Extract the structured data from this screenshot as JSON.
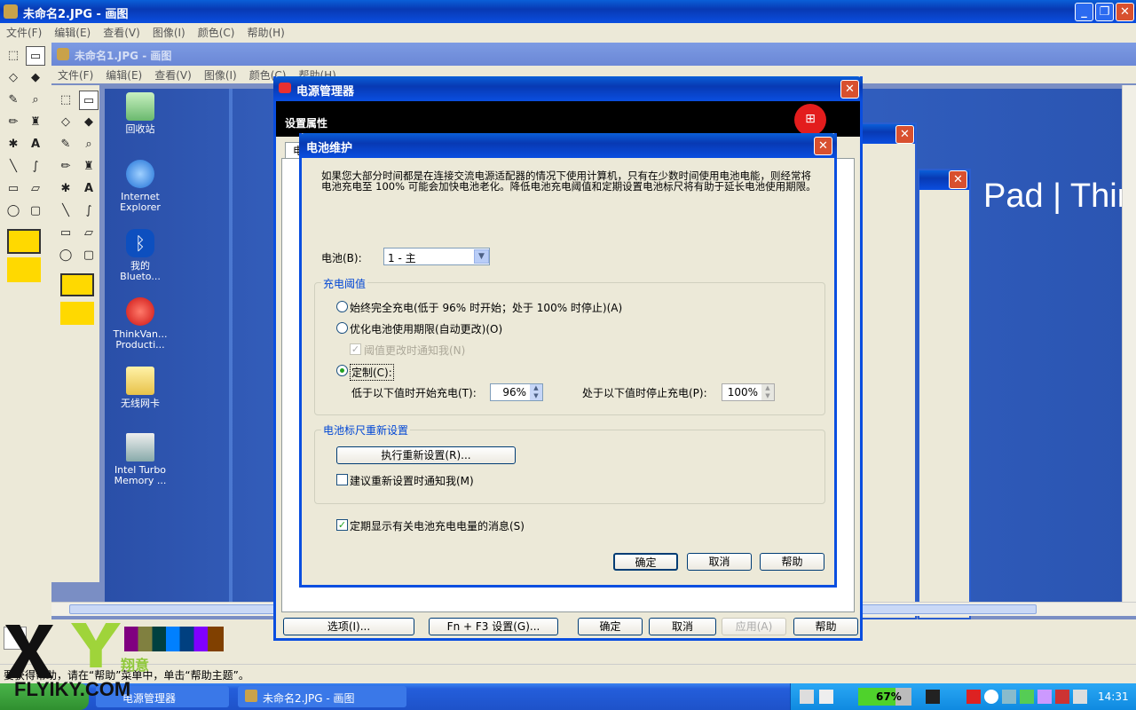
{
  "outer_window": {
    "title": "未命名2.JPG - 画图",
    "menu": [
      "文件(F)",
      "编辑(E)",
      "查看(V)",
      "图像(I)",
      "颜色(C)",
      "帮助(H)"
    ],
    "status": "要获得帮助，请在“帮助”菜单中，单击“帮助主题”。"
  },
  "inner_window": {
    "title": "未命名1.JPG - 画图",
    "menu": [
      "文件(F)",
      "编辑(E)",
      "查看(V)",
      "图像(I)",
      "颜色(C)",
      "帮助(H)"
    ]
  },
  "desktop_icons": [
    {
      "label": "回收站"
    },
    {
      "label": "Internet Explorer"
    },
    {
      "label": "我的 Blueto..."
    },
    {
      "label": "ThinkVan... Producti..."
    },
    {
      "label": "无线网卡"
    },
    {
      "label": "Intel Turbo Memory ..."
    }
  ],
  "wallpaper_text": "Pad | ThinkCen",
  "power_manager": {
    "title": "电源管理器",
    "header": "设置属性",
    "tab_label": "电",
    "buttons": {
      "options": "选项(I)...",
      "fn_f3": "Fn + F3 设置(G)...",
      "ok": "确定",
      "cancel": "取消",
      "apply": "应用(A)",
      "help": "帮助"
    }
  },
  "battery_dialog": {
    "title": "电池维护",
    "description": "如果您大部分时间都是在连接交流电源适配器的情况下使用计算机，只有在少数时间使用电池电能，则经常将电池充电至 100% 可能会加快电池老化。降低电池充电阈值和定期设置电池标尺将有助于延长电池使用期限。",
    "battery_label": "电池(B):",
    "battery_value": "1 - 主",
    "threshold_group": "充电阈值",
    "opt_full": "始终完全充电(低于 96% 时开始；处于 100% 时停止)(A)",
    "opt_optimize": "优化电池使用期限(自动更改)(O)",
    "notify_change": "阈值更改时通知我(N)",
    "opt_custom": "定制(C):",
    "start_label": "低于以下值时开始充电(T):",
    "start_value": "96%",
    "stop_label": "处于以下值时停止充电(P):",
    "stop_value": "100%",
    "gauge_group": "电池标尺重新设置",
    "reset_button": "执行重新设置(R)...",
    "notify_reset": "建议重新设置时通知我(M)",
    "periodic": "定期显示有关电池充电电量的消息(S)",
    "ok": "确定",
    "cancel": "取消",
    "help": "帮助"
  },
  "taskbar": {
    "items": [
      "电源管理器",
      "未命名2.JPG - 画图"
    ],
    "battery_percent": "67%",
    "clock": "14:31"
  },
  "watermark": {
    "text": "FLYIKY.COM",
    "sub": "翔意"
  },
  "colors": {
    "desktop_blue": "#2f5fc0",
    "xp_title": "#0a4ee0",
    "close_red": "#d8502f",
    "taskbar": "#245edb",
    "battery_green": "#4fd22c"
  }
}
